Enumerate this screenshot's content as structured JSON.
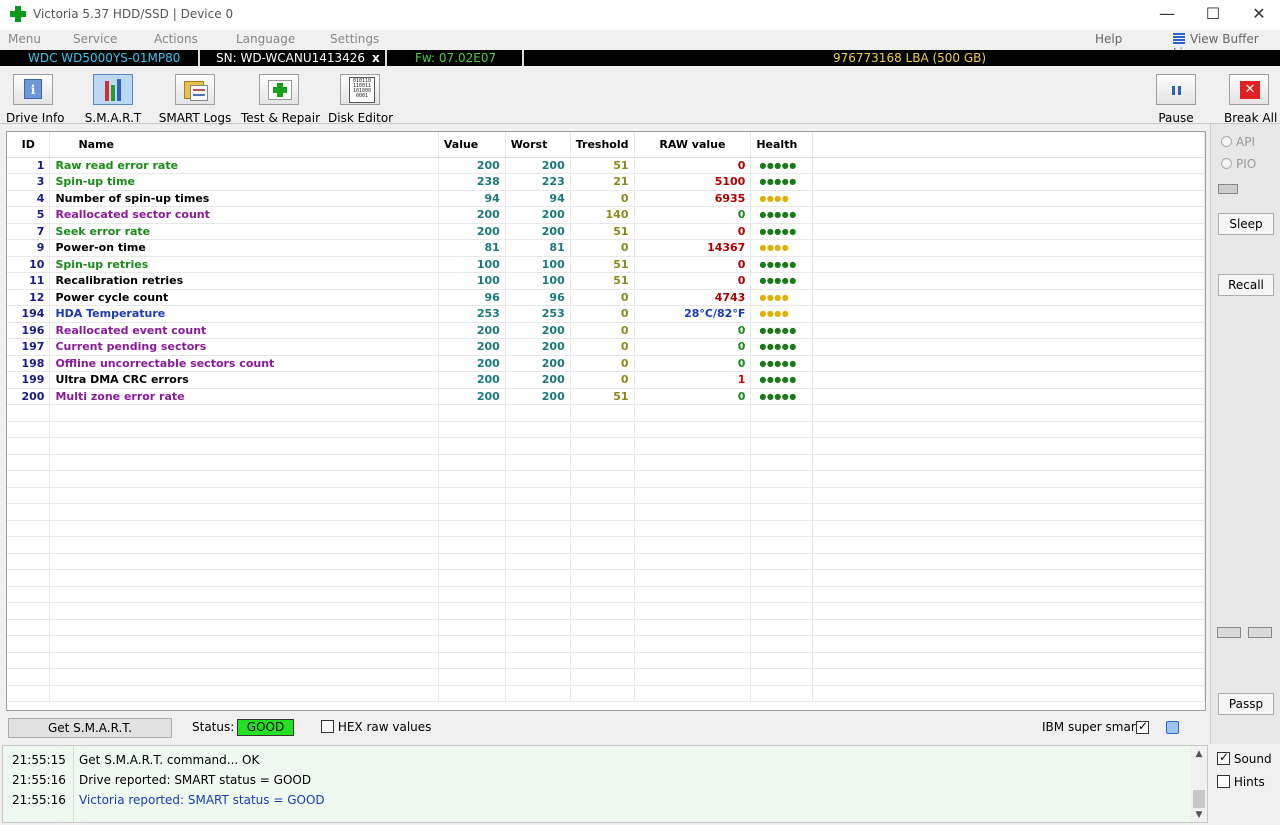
{
  "window": {
    "title": "Victoria 5.37 HDD/SSD | Device 0",
    "minimize": "—",
    "maximize": "☐",
    "close": "✕"
  },
  "menu": {
    "items": [
      "Menu",
      "Service",
      "Actions",
      "Language",
      "Settings"
    ],
    "help": "Help",
    "view_buffer": "View Buffer Live"
  },
  "info": {
    "model": "WDC WD5000YS-01MP80",
    "serial": "SN: WD-WCANU1413426",
    "close_x": "x",
    "firmware": "Fw: 07.02E07",
    "capacity": "976773168 LBA (500 GB)",
    "colors": {
      "model": "#35c8f0",
      "serial": "#ffffff",
      "firmware": "#4fcf3f",
      "capacity": "#f0d040"
    }
  },
  "toolbar": {
    "buttons": [
      {
        "name": "drive-info-button",
        "label": "Drive Info",
        "icon": "info-icon",
        "active": false
      },
      {
        "name": "smart-button",
        "label": "S.M.A.R.T",
        "icon": "smart-chart-icon",
        "active": true
      },
      {
        "name": "smart-logs-button",
        "label": "SMART Logs",
        "icon": "logs-icon",
        "active": false
      },
      {
        "name": "test-repair-button",
        "label": "Test & Repair",
        "icon": "test-repair-icon",
        "active": false
      },
      {
        "name": "disk-editor-button",
        "label": "Disk Editor",
        "icon": "disk-editor-icon",
        "active": false
      }
    ],
    "pause": "Pause",
    "break_all": "Break All",
    "disk_editor_bits": "010110\n110011\n101000\n0001"
  },
  "table": {
    "headers": {
      "id": "ID",
      "name": "Name",
      "value": "Value",
      "worst": "Worst",
      "threshold": "Treshold",
      "raw": "RAW value",
      "health": "Health"
    },
    "rows": [
      {
        "id": "1",
        "name": "Raw read error rate",
        "value": "200",
        "worst": "200",
        "threshold": "51",
        "raw": "0",
        "health": "●●●●●",
        "name_color": "#1a8a1a",
        "raw_color": "#b00000",
        "health_color": "#1a7a1a"
      },
      {
        "id": "3",
        "name": "Spin-up time",
        "value": "238",
        "worst": "223",
        "threshold": "21",
        "raw": "5100",
        "health": "●●●●●",
        "name_color": "#1a8a1a",
        "raw_color": "#b00000",
        "health_color": "#1a7a1a"
      },
      {
        "id": "4",
        "name": "Number of spin-up times",
        "value": "94",
        "worst": "94",
        "threshold": "0",
        "raw": "6935",
        "health": "●●●●",
        "name_color": "#000000",
        "raw_color": "#b00000",
        "health_color": "#e0b000"
      },
      {
        "id": "5",
        "name": "Reallocated sector count",
        "value": "200",
        "worst": "200",
        "threshold": "140",
        "raw": "0",
        "health": "●●●●●",
        "name_color": "#8a1a9a",
        "raw_color": "#1a8a1a",
        "health_color": "#1a7a1a"
      },
      {
        "id": "7",
        "name": "Seek error rate",
        "value": "200",
        "worst": "200",
        "threshold": "51",
        "raw": "0",
        "health": "●●●●●",
        "name_color": "#1a8a1a",
        "raw_color": "#b00000",
        "health_color": "#1a7a1a"
      },
      {
        "id": "9",
        "name": "Power-on time",
        "value": "81",
        "worst": "81",
        "threshold": "0",
        "raw": "14367",
        "health": "●●●●",
        "name_color": "#000000",
        "raw_color": "#b00000",
        "health_color": "#e0b000"
      },
      {
        "id": "10",
        "name": "Spin-up retries",
        "value": "100",
        "worst": "100",
        "threshold": "51",
        "raw": "0",
        "health": "●●●●●",
        "name_color": "#1a8a1a",
        "raw_color": "#b00000",
        "health_color": "#1a7a1a"
      },
      {
        "id": "11",
        "name": "Recalibration retries",
        "value": "100",
        "worst": "100",
        "threshold": "51",
        "raw": "0",
        "health": "●●●●●",
        "name_color": "#000000",
        "raw_color": "#b00000",
        "health_color": "#1a7a1a"
      },
      {
        "id": "12",
        "name": "Power cycle count",
        "value": "96",
        "worst": "96",
        "threshold": "0",
        "raw": "4743",
        "health": "●●●●",
        "name_color": "#000000",
        "raw_color": "#b00000",
        "health_color": "#e0b000"
      },
      {
        "id": "194",
        "name": "HDA Temperature",
        "value": "253",
        "worst": "253",
        "threshold": "0",
        "raw": "28°C/82°F",
        "health": "●●●●",
        "name_color": "#1a3ab8",
        "raw_color": "#1a3ab8",
        "health_color": "#e0b000"
      },
      {
        "id": "196",
        "name": "Reallocated event count",
        "value": "200",
        "worst": "200",
        "threshold": "0",
        "raw": "0",
        "health": "●●●●●",
        "name_color": "#8a1a9a",
        "raw_color": "#1a8a1a",
        "health_color": "#1a7a1a"
      },
      {
        "id": "197",
        "name": "Current pending sectors",
        "value": "200",
        "worst": "200",
        "threshold": "0",
        "raw": "0",
        "health": "●●●●●",
        "name_color": "#8a1a9a",
        "raw_color": "#1a8a1a",
        "health_color": "#1a7a1a"
      },
      {
        "id": "198",
        "name": "Offline uncorrectable sectors count",
        "value": "200",
        "worst": "200",
        "threshold": "0",
        "raw": "0",
        "health": "●●●●●",
        "name_color": "#8a1a9a",
        "raw_color": "#1a8a1a",
        "health_color": "#1a7a1a"
      },
      {
        "id": "199",
        "name": "Ultra DMA CRC errors",
        "value": "200",
        "worst": "200",
        "threshold": "0",
        "raw": "1",
        "health": "●●●●●",
        "name_color": "#000000",
        "raw_color": "#d00000",
        "health_color": "#1a7a1a"
      },
      {
        "id": "200",
        "name": "Multi zone error rate",
        "value": "200",
        "worst": "200",
        "threshold": "51",
        "raw": "0",
        "health": "●●●●●",
        "name_color": "#8a1a9a",
        "raw_color": "#1a8a1a",
        "health_color": "#1a7a1a"
      }
    ],
    "empty_rows": 18,
    "id_color": "#1a1a8a",
    "value_color": "#1a7a7a",
    "threshold_color": "#8a8a1a"
  },
  "side": {
    "api": "API",
    "pio": "PIO",
    "sleep": "Sleep",
    "recall": "Recall",
    "passp": "Passp",
    "sound": "Sound",
    "hints": "Hints",
    "sound_checked": true,
    "hints_checked": false
  },
  "status": {
    "get_smart": "Get S.M.A.R.T.",
    "label": "Status:",
    "value": "GOOD",
    "value_color": "#22e022",
    "hex_raw": "HEX raw values",
    "hex_checked": false,
    "ibm": "IBM super smart:",
    "ibm_checked": true
  },
  "log": [
    {
      "time": "21:55:15",
      "msg": "Get S.M.A.R.T. command... OK",
      "color": "#000000"
    },
    {
      "time": "21:55:16",
      "msg": "Drive reported: SMART status = GOOD",
      "color": "#000000"
    },
    {
      "time": "21:55:16",
      "msg": "Victoria reported: SMART status = GOOD",
      "color": "#1a3ab8"
    }
  ]
}
